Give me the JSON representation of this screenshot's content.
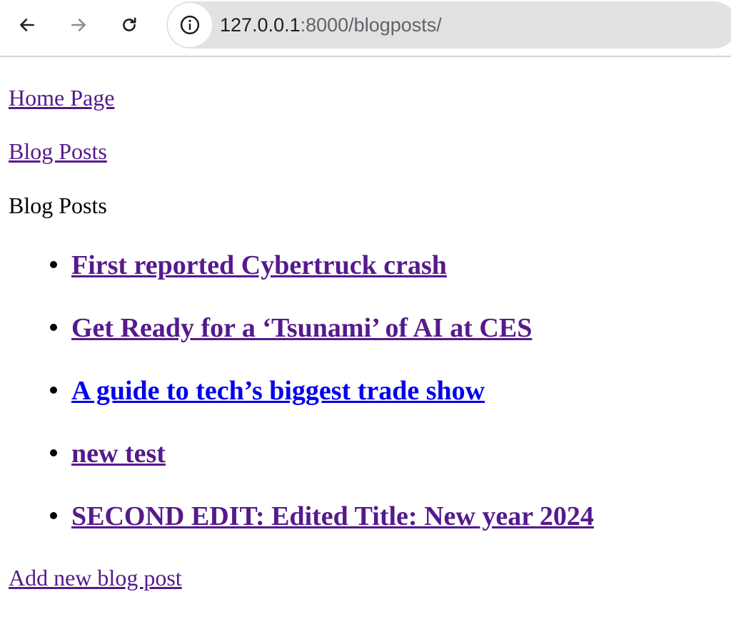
{
  "browser": {
    "url_host": "127.0.0.1",
    "url_rest": ":8000/blogposts/",
    "icons": {
      "back": "arrow-left-icon",
      "forward": "arrow-right-icon",
      "reload": "reload-icon",
      "site_info": "info-icon"
    }
  },
  "nav": {
    "home_label": "Home Page",
    "blog_label": "Blog Posts"
  },
  "page": {
    "heading": "Blog Posts",
    "posts": [
      {
        "title": "First reported Cybertruck crash",
        "visited": true
      },
      {
        "title": "Get Ready for a ‘Tsunami’ of AI at CES",
        "visited": true
      },
      {
        "title": "A guide to tech’s biggest trade show",
        "visited": false
      },
      {
        "title": "new test",
        "visited": true
      },
      {
        "title": "SECOND EDIT: Edited Title: New year 2024",
        "visited": true
      }
    ],
    "add_label": "Add new blog post"
  },
  "colors": {
    "visited_link": "#551a8b",
    "unvisited_link": "#0000ee",
    "omnibox_bg": "#e2e2e2"
  }
}
